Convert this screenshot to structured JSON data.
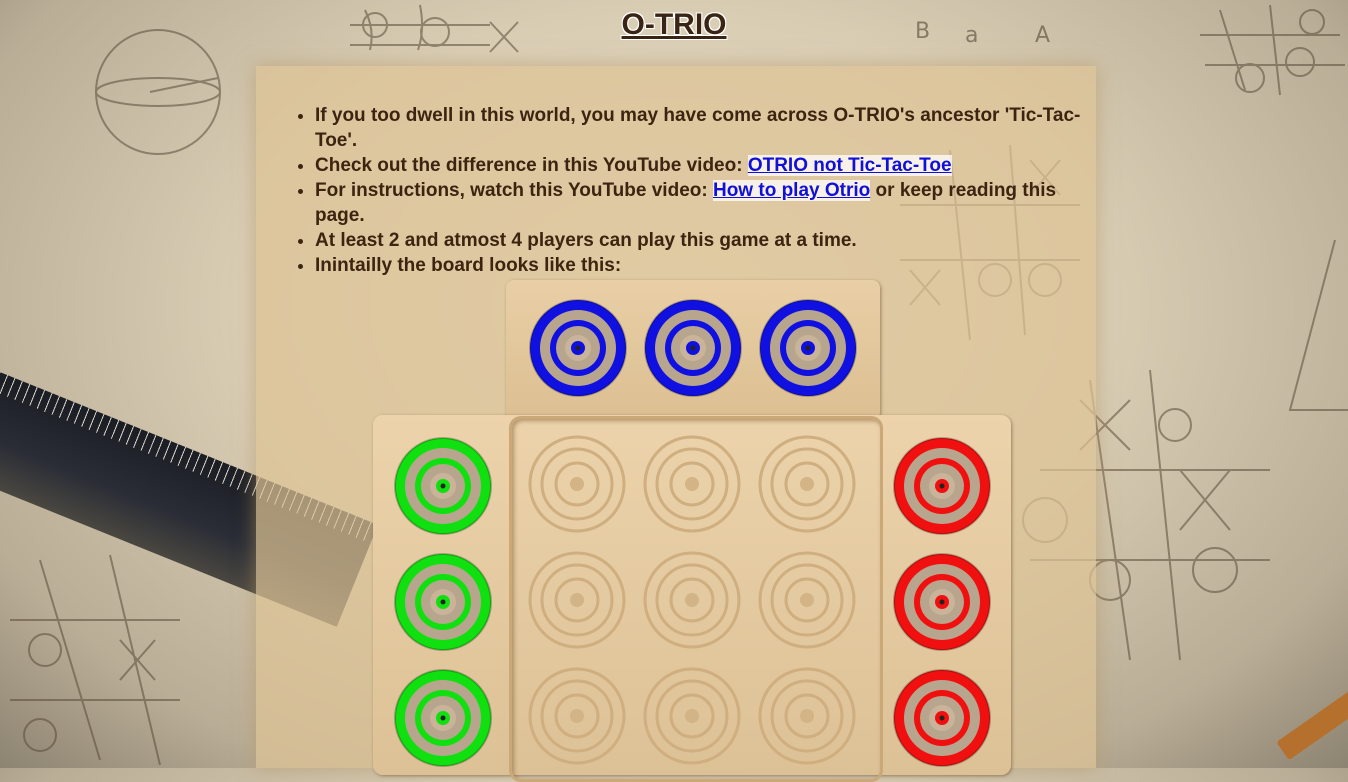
{
  "page": {
    "title": "O-TRIO"
  },
  "intro": {
    "items": [
      {
        "text": "If you too dwell in this world, you may have come across O-TRIO's ancestor 'Tic-Tac-Toe'."
      },
      {
        "text_before": "Check out the difference in this YouTube video: ",
        "link": "OTRIO not Tic-Tac-Toe",
        "text_after": ""
      },
      {
        "text_before": "For instructions, watch this YouTube video: ",
        "link": "How to play Otrio",
        "text_after": " or keep reading this page."
      },
      {
        "text": "At least 2 and atmost 4 players can play this game at a time."
      },
      {
        "text": "Inintailly the board looks like this:"
      }
    ]
  },
  "board": {
    "colors": {
      "blue": "#1010e0",
      "green": "#10e010",
      "red": "#f01010",
      "wood": "#e3c79d"
    },
    "top_pieces": [
      "blue",
      "blue",
      "blue"
    ],
    "left_pieces": [
      "green",
      "green",
      "green"
    ],
    "right_pieces": [
      "red",
      "red",
      "red"
    ],
    "grid": "3x3 empty"
  }
}
